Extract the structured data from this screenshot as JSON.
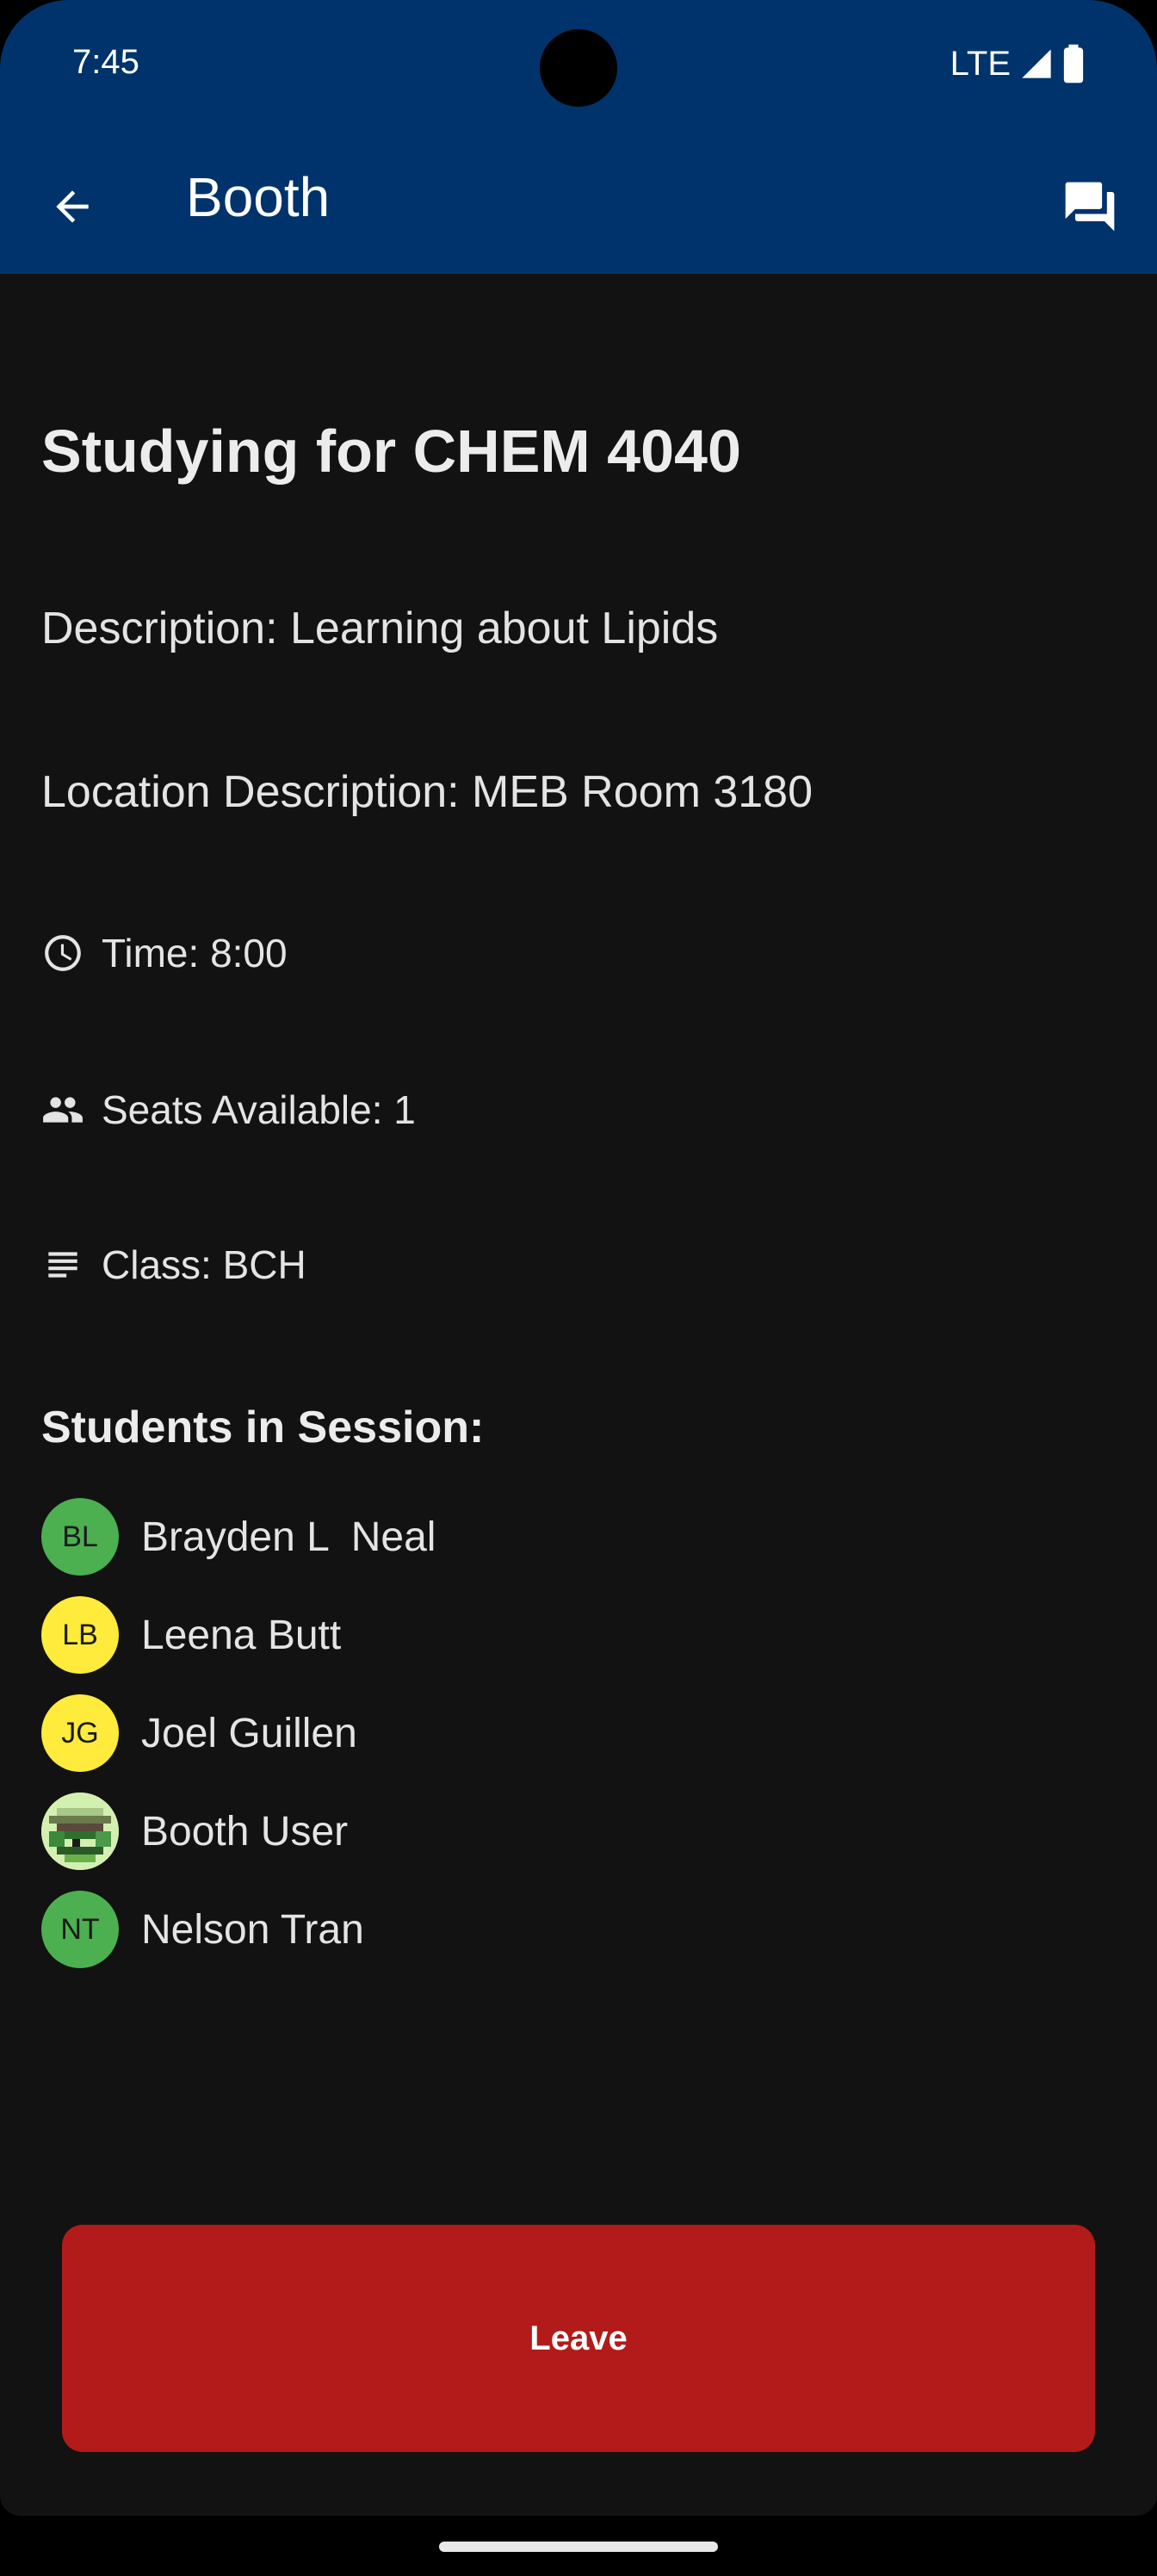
{
  "status_bar": {
    "time": "7:45",
    "network": "LTE"
  },
  "app_bar": {
    "title": "Booth",
    "back_icon": "arrow-back-icon",
    "chat_icon": "forum-icon"
  },
  "session": {
    "title": "Studying for CHEM 4040",
    "description": "Description: Learning about Lipids",
    "location": "Location Description: MEB Room 3180",
    "time": "Time: 8:00",
    "seats": "Seats Available: 1",
    "class": "Class: BCH"
  },
  "students": {
    "heading": "Students in Session:",
    "list": [
      {
        "initials": "BL",
        "name": "Brayden L  Neal",
        "avatar_color": "#4caf50"
      },
      {
        "initials": "LB",
        "name": "Leena Butt",
        "avatar_color": "#ffeb3b"
      },
      {
        "initials": "JG",
        "name": "Joel Guillen",
        "avatar_color": "#ffeb3b"
      },
      {
        "initials": "",
        "name": "Booth User",
        "avatar_color": "image"
      },
      {
        "initials": "NT",
        "name": "Nelson Tran",
        "avatar_color": "#4caf50"
      }
    ]
  },
  "actions": {
    "leave_label": "Leave"
  },
  "colors": {
    "app_bar": "#00336b",
    "background": "#121212",
    "leave_button": "#b31a1a"
  }
}
